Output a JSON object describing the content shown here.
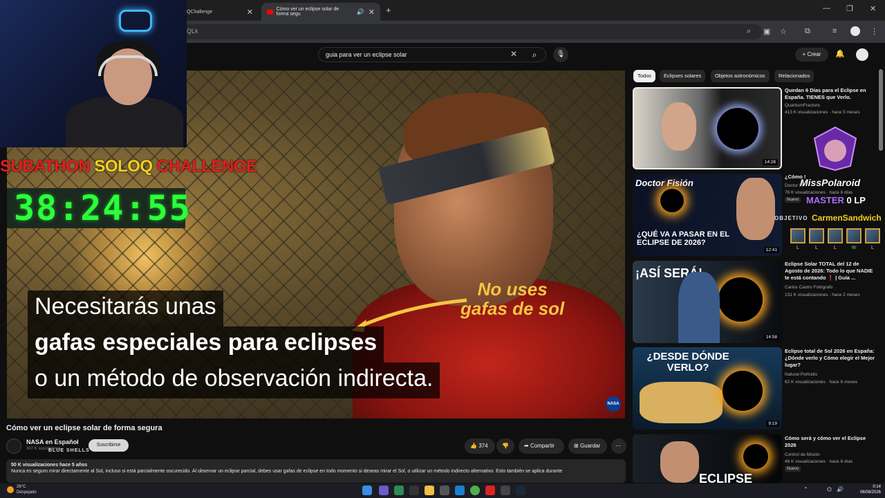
{
  "browser": {
    "tabs": [
      {
        "label": "QChallenge"
      },
      {
        "label": "Cómo ver un eclipse solar de forma segu",
        "active": true
      }
    ],
    "address": "QLk"
  },
  "youtube": {
    "search_value": "guia para ver un eclipse solar",
    "create_label": "Crear"
  },
  "video": {
    "caption_line1": "Necesitarás unas",
    "caption_line2": "gafas especiales para eclipses",
    "caption_line3": "o un método de observación indirecta.",
    "annotation_line1": "No uses",
    "annotation_line2": "gafas de sol",
    "watermark": "NASA"
  },
  "stream_overlay": {
    "subathon_1": "SUBATHON ",
    "subathon_2": "SOLOQ",
    "subathon_3": " CHALLENGE",
    "timer": "38:24:55",
    "summoner": "MissPolaroid",
    "rank": "MASTER",
    "lp": "0 LP",
    "objective_label": "OBJETIVO",
    "objective_target": "CarmenSandwich",
    "results": [
      "L",
      "L",
      "L",
      "W",
      "L"
    ],
    "shells": "BLUE SHELLS"
  },
  "watch": {
    "title": "Cómo ver un eclipse solar de forma segura",
    "channel": "NASA en Español",
    "subscribers": "307 K suscriptores",
    "subscribe_label": "Suscribirse",
    "likes": "374",
    "share_label": "Compartir",
    "save_label": "Guardar",
    "desc_meta": "50 K visualizaciones  hace 5 años",
    "desc_text": "Nunca es seguro mirar directamente al Sol, incluso si está parcialmente oscurecido. Al observar un eclipse parcial, debes usar gafas de eclipse en todo momento si deseas mirar el Sol, o utilizar un método indirecto alternativo. Esto también se aplica durante"
  },
  "chips": [
    "Todos",
    "Eclipses solares",
    "Objetos astronómicos",
    "Relacionados"
  ],
  "related": [
    {
      "title": "Quedan 6 Días para el Eclipse en España. TIENES que Verlo.",
      "channel": "QuantumFracture",
      "meta": "413 K visualizaciones · hace 5 meses",
      "duration": "14:28"
    },
    {
      "title": "¿Cómo Será el Eclipse de 2026?",
      "channel": "Doctor Fision",
      "meta": "76 K visualizaciones · hace 6 días",
      "duration": "12:41",
      "badge": "Nuevo",
      "thumb_text": "¿QUÉ VA A PASAR EN EL ECLIPSE DE 2026?",
      "thumb_brand": "Doctor Fisión"
    },
    {
      "title": "Eclipse Solar TOTAL del 12 de Agosto de 2026: Todo lo que NADIE te está contando ❗ | Guía ...",
      "channel": "Carlos Castro Fotógrafo",
      "meta": "131 K visualizaciones · hace 2 meses",
      "duration": "14:58",
      "thumb_text": "¡ASÍ SERÁ!"
    },
    {
      "title": "Eclipse total de Sol 2026 en España: ¿Dónde verlo y Cómo elegir el Mejor lugar?",
      "channel": "Natural Portraits",
      "meta": "62 K visualizaciones · hace 6 meses",
      "duration": "9:19",
      "thumb_text": "¿DESDE DÓNDE VERLO?"
    },
    {
      "title": "Cómo será y cómo ver el Eclipse 2026",
      "channel": "Control de Misión",
      "meta": "46 K visualizaciones · hace 6 días",
      "badge": "Nuevo",
      "thumb_text": "ECLIPSE"
    }
  ],
  "taskbar": {
    "weather_temp": "26°C",
    "weather_desc": "Despejado",
    "time": "0:14",
    "date": "06/08/2026"
  },
  "colors": {
    "timer": "#2cff3a",
    "subathon_red": "#e51d1d",
    "annotation": "#f5c542",
    "rank": "#b06cff"
  }
}
